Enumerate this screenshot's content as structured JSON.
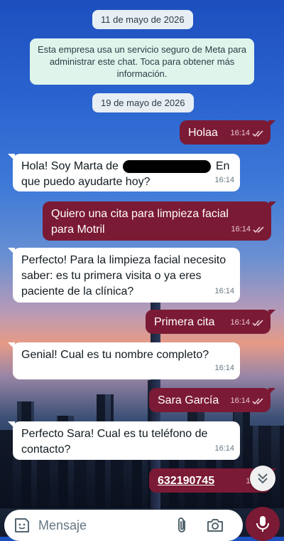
{
  "dates": {
    "first": "11 de mayo de 2026",
    "second": "19 de mayo de 2026"
  },
  "notice": "Esta empresa usa un servicio seguro de Meta para administrar este chat. Toca para obtener más información.",
  "messages": [
    {
      "dir": "out",
      "text": "Holaa",
      "time": "16:14"
    },
    {
      "dir": "in",
      "text_before": "Hola! Soy Marta de",
      "text_after": "En que puedo ayudarte hoy?",
      "time": "16:14"
    },
    {
      "dir": "out",
      "text": "Quiero una cita para limpieza facial para Motril",
      "time": "16:14"
    },
    {
      "dir": "in",
      "text": "Perfecto! Para la limpieza facial necesito saber: es tu primera visita o ya eres paciente de la clínica?",
      "time": "16:14"
    },
    {
      "dir": "out",
      "text": "Primera cita",
      "time": "16:14"
    },
    {
      "dir": "in",
      "text": "Genial! Cual es tu nombre completo?",
      "time": "16:14"
    },
    {
      "dir": "out",
      "text": "Sara García",
      "time": "16:14"
    },
    {
      "dir": "in",
      "text": "Perfecto Sara! Cual es tu teléfono de contacto?",
      "time": "16:14"
    },
    {
      "dir": "out",
      "text": "632190745",
      "time": "16:14"
    }
  ],
  "composer": {
    "placeholder": "Mensaje"
  },
  "icons": {
    "sticker": "sticker-icon",
    "attach": "paperclip-icon",
    "camera": "camera-icon",
    "mic": "microphone-icon",
    "scroll": "chevron-double-down-icon",
    "read": "double-check-icon"
  },
  "colors": {
    "outgoing": "#7b1a35",
    "incoming": "#ffffff",
    "system": "#e7eef4",
    "notice": "#dff5ec"
  }
}
